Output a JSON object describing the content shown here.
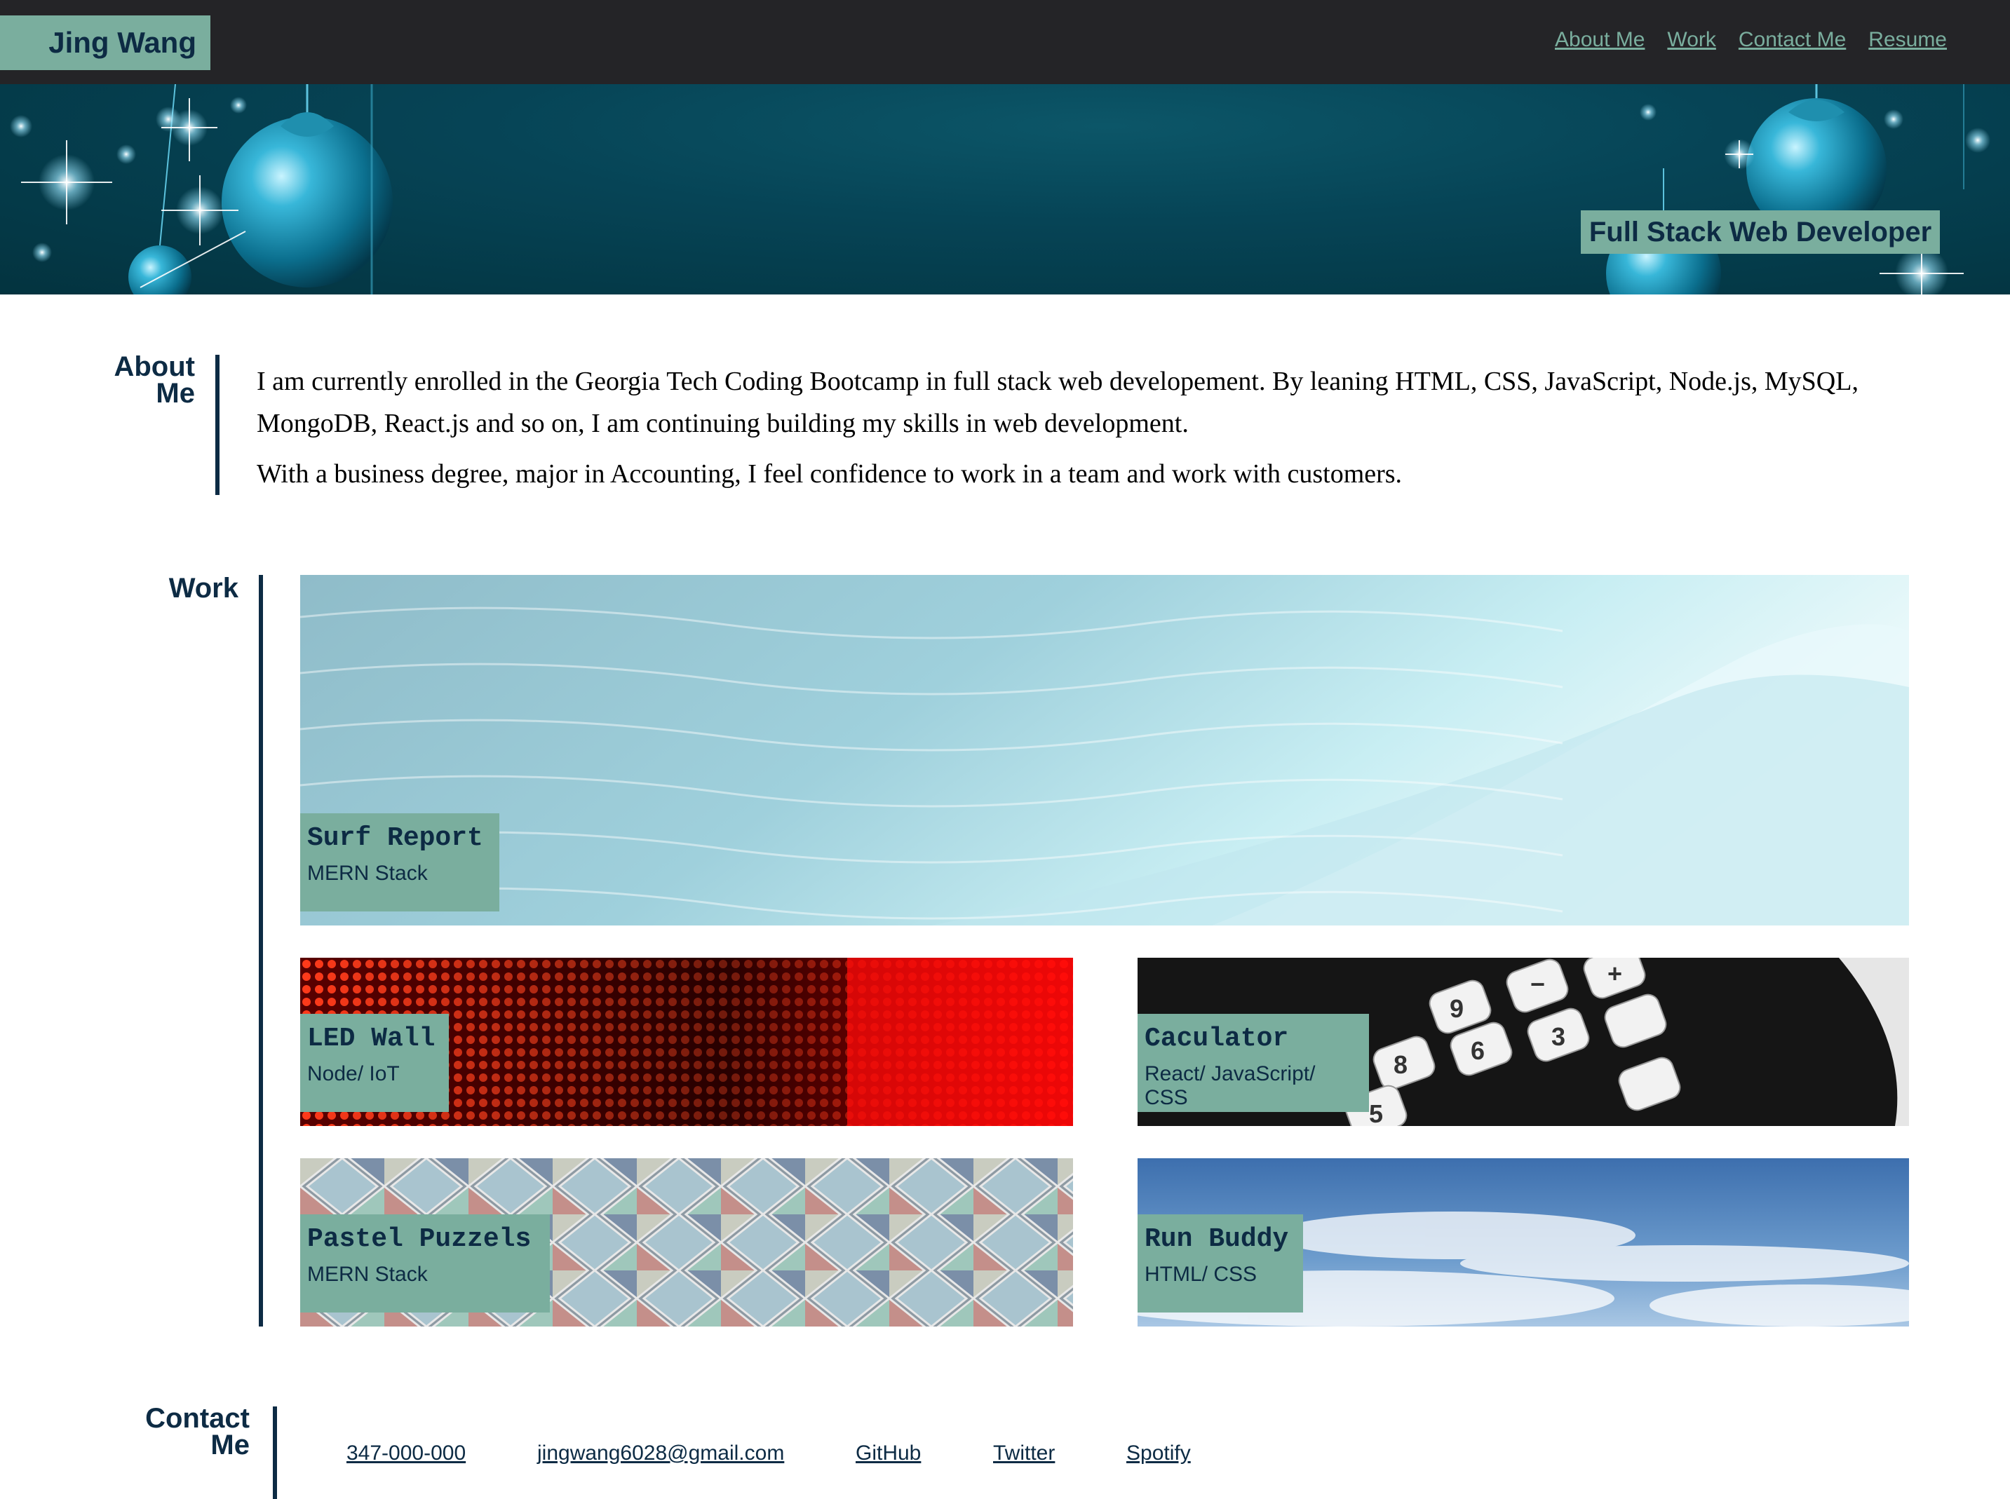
{
  "header": {
    "brand": "Jing Wang",
    "nav": [
      "About Me",
      "Work",
      "Contact Me",
      "Resume"
    ],
    "tagline": "Full Stack Web Developer"
  },
  "about": {
    "title_line1": "About",
    "title_line2": "Me",
    "paragraph1": "I am currently enrolled in the Georgia Tech Coding Bootcamp in full stack web developement. By leaning HTML, CSS, JavaScript, Node.js, MySQL, MongoDB, React.js and so on, I am continuing building my skills in web development.",
    "paragraph2": "With a business degree, major in Accounting, I feel confidence to work in a team and work with customers."
  },
  "work": {
    "title": "Work",
    "projects": [
      {
        "title": "Surf Report",
        "stack": "MERN Stack",
        "image": "ocean-wave"
      },
      {
        "title": "LED Wall",
        "stack": "Node/ IoT",
        "image": "red-led-panel"
      },
      {
        "title": "Caculator",
        "stack": "React/ JavaScript/ CSS",
        "image": "calculator-keys"
      },
      {
        "title": "Pastel Puzzels",
        "stack": "MERN Stack",
        "image": "pastel-tiles"
      },
      {
        "title": "Run Buddy",
        "stack": "HTML/ CSS",
        "image": "blue-sky"
      }
    ]
  },
  "contact": {
    "title_line1": "Contact",
    "title_line2": "Me",
    "links": [
      "347-000-000",
      "jingwang6028@gmail.com",
      "GitHub",
      "Twitter",
      "Spotify"
    ]
  },
  "colors": {
    "header_bg": "#242427",
    "accent": "#7aae9e",
    "navy": "#0d2b44",
    "hero_teal": "#064456"
  }
}
